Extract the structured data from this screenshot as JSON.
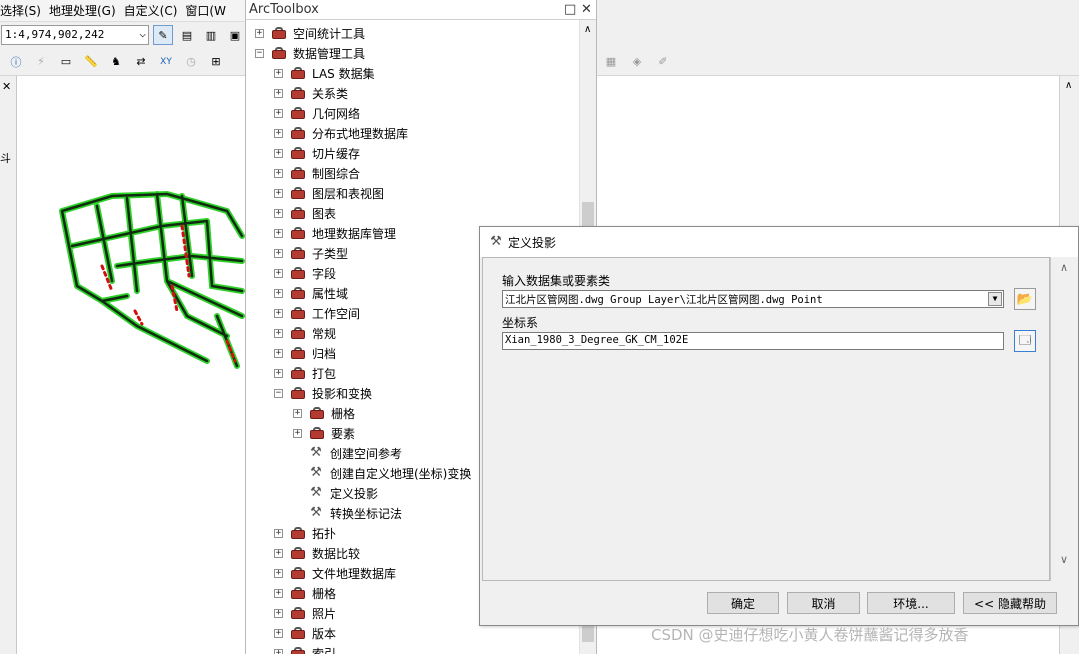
{
  "menu": {
    "items": [
      "选择(S)",
      "地理处理(G)",
      "自定义(C)",
      "窗口(W"
    ]
  },
  "toolbar": {
    "scale_value": "1:4,974,902,242"
  },
  "left_edge": {
    "char": "斗"
  },
  "arctoolbox": {
    "title": "ArcToolbox",
    "items": [
      {
        "label": "空间统计工具"
      },
      {
        "label": "数据管理工具"
      },
      {
        "label": "LAS 数据集"
      },
      {
        "label": "关系类"
      },
      {
        "label": "几何网络"
      },
      {
        "label": "分布式地理数据库"
      },
      {
        "label": "切片缓存"
      },
      {
        "label": "制图综合"
      },
      {
        "label": "图层和表视图"
      },
      {
        "label": "图表"
      },
      {
        "label": "地理数据库管理"
      },
      {
        "label": "子类型"
      },
      {
        "label": "字段"
      },
      {
        "label": "属性域"
      },
      {
        "label": "工作空间"
      },
      {
        "label": "常规"
      },
      {
        "label": "归档"
      },
      {
        "label": "打包"
      },
      {
        "label": "投影和变换"
      },
      {
        "label": "栅格"
      },
      {
        "label": "要素"
      },
      {
        "label": "创建空间参考"
      },
      {
        "label": "创建自定义地理(坐标)变换"
      },
      {
        "label": "定义投影"
      },
      {
        "label": "转换坐标记法"
      },
      {
        "label": "拓扑"
      },
      {
        "label": "数据比较"
      },
      {
        "label": "文件地理数据库"
      },
      {
        "label": "栅格"
      },
      {
        "label": "照片"
      },
      {
        "label": "版本"
      },
      {
        "label": "索引"
      }
    ]
  },
  "dialog": {
    "title": "定义投影",
    "input_label": "输入数据集或要素类",
    "input_value": "江北片区管网图.dwg Group Layer\\江北片区管网图.dwg Point",
    "coord_label": "坐标系",
    "coord_value": "Xian_1980_3_Degree_GK_CM_102E",
    "ok": "确定",
    "cancel": "取消",
    "env": "环境...",
    "hide_help": "<< 隐藏帮助"
  },
  "watermark": "CSDN @史迪仔想吃小黄人卷饼蘸酱记得多放香",
  "colors": {
    "toolbox_icon": "#b33b32",
    "road_green": "#2fd12a",
    "road_red": "#d01010"
  }
}
